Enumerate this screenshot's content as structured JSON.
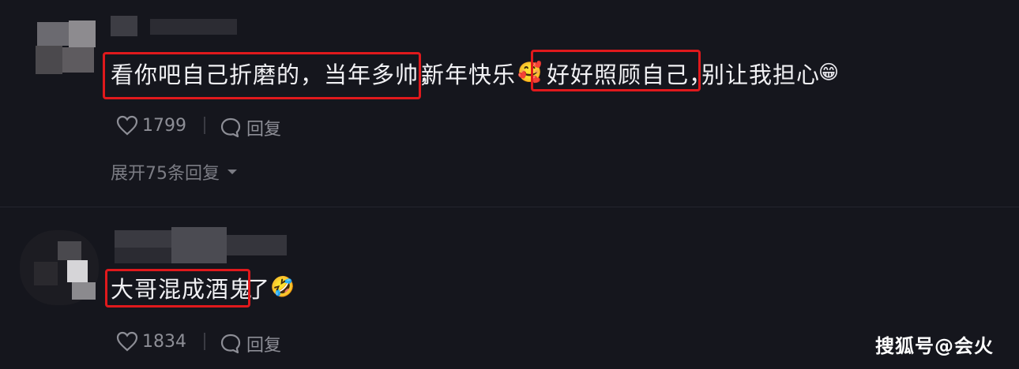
{
  "comments": [
    {
      "text_parts": [
        "看你吧自己折磨的，当年多帅，",
        "新年快乐",
        "好好照顾自己，",
        "别让我担心"
      ],
      "likes": "1799",
      "reply_label": "回复",
      "expand_label": "展开75条回复"
    },
    {
      "text_parts": [
        "大哥混成酒鬼",
        "了"
      ],
      "likes": "1834",
      "reply_label": "回复"
    }
  ],
  "icons": {
    "like": "heart-outline-icon",
    "reply": "speech-bubble-icon",
    "expand": "caret-down-icon",
    "emoji_1": "blushing-face-emoji",
    "emoji_2": "grinning-face-emoji",
    "emoji_3": "rolling-laughing-emoji"
  },
  "colors": {
    "background": "#15161d",
    "highlight_box": "#e0191c",
    "secondary_text": "#8d8e96"
  },
  "watermark": "搜狐号@会火"
}
